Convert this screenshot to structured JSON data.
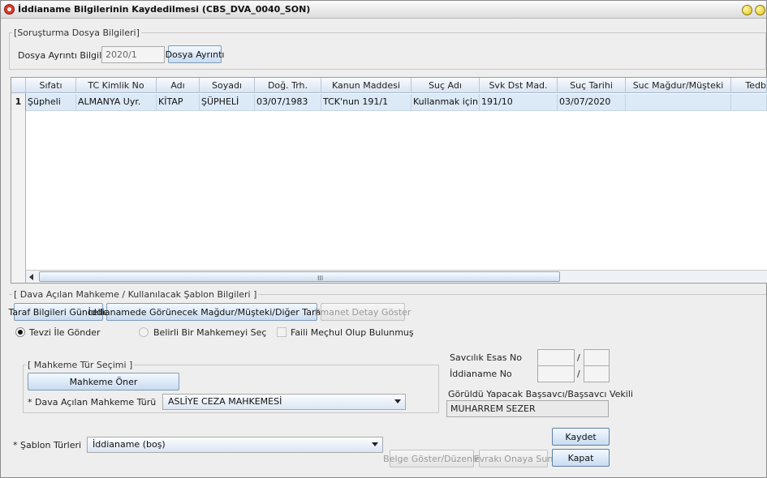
{
  "window": {
    "title": "İddianame Bilgilerinin Kaydedilmesi (CBS_DVA_0040_SON)"
  },
  "sorusturma": {
    "legend": "[Soruşturma Dosya Bilgileri]",
    "dosya_label": "Dosya Ayrıntı Bilgileri :",
    "dosya_value": "2020/1",
    "dosya_button": "Dosya Ayrıntı"
  },
  "table": {
    "columns": [
      "Sıfatı",
      "TC Kimlik No",
      "Adı",
      "Soyadı",
      "Doğ. Trh.",
      "Kanun Maddesi",
      "Suç Adı",
      "Svk Dst Mad.",
      "Suç Tarihi",
      "Suc Mağdur/Müşteki",
      "Tedb"
    ],
    "rows": [
      {
        "index": "1",
        "cells": [
          "Şüpheli",
          "ALMANYA Uyr.",
          "KİTAP",
          "ŞÜPHELİ",
          "03/07/1983",
          "TCK'nun 191/1",
          "Kullanmak için...",
          "191/10",
          "03/07/2020",
          "",
          ""
        ]
      }
    ],
    "scroll_grip": "III"
  },
  "dava": {
    "legend": "[ Dava Açılan Mahkeme / Kullanılacak Şablon Bilgileri ]",
    "btn_taraf": "Taraf Bilgileri Güncelle",
    "btn_iddianame": "İddianamede Görünecek Mağdur/Müşteki/Diğer Taraflar",
    "btn_emanet": "Emanet Detay Göster",
    "radio_tevzi": "Tevzi İle Gönder",
    "radio_belirli": "Belirli Bir Mahkemeyi Seç",
    "check_faili": "Faili Meçhul Olup Bulunmuş"
  },
  "mahkeme": {
    "legend": "[ Mahkeme Tür Seçimi ]",
    "btn_oner": "Mahkeme Öner",
    "tur_label": "* Dava Açılan Mahkeme Türü",
    "tur_value": "ASLİYE CEZA MAHKEMESİ"
  },
  "savcilik": {
    "esas_label": "Savcılık Esas No",
    "iddianame_label": "İddianame No",
    "slash": "/",
    "goruldu_label": "Görüldü Yapacak Başsavcı/Başsavcı Vekili",
    "goruldu_value": "MUHARREM SEZER"
  },
  "sablon": {
    "label": "* Şablon Türleri",
    "value": "İddianame (boş)",
    "btn_belge": "Belge Göster/Düzenle",
    "btn_evrak": "Evrakı Onaya Sun",
    "btn_kaydet": "Kaydet",
    "btn_kapat": "Kapat"
  }
}
